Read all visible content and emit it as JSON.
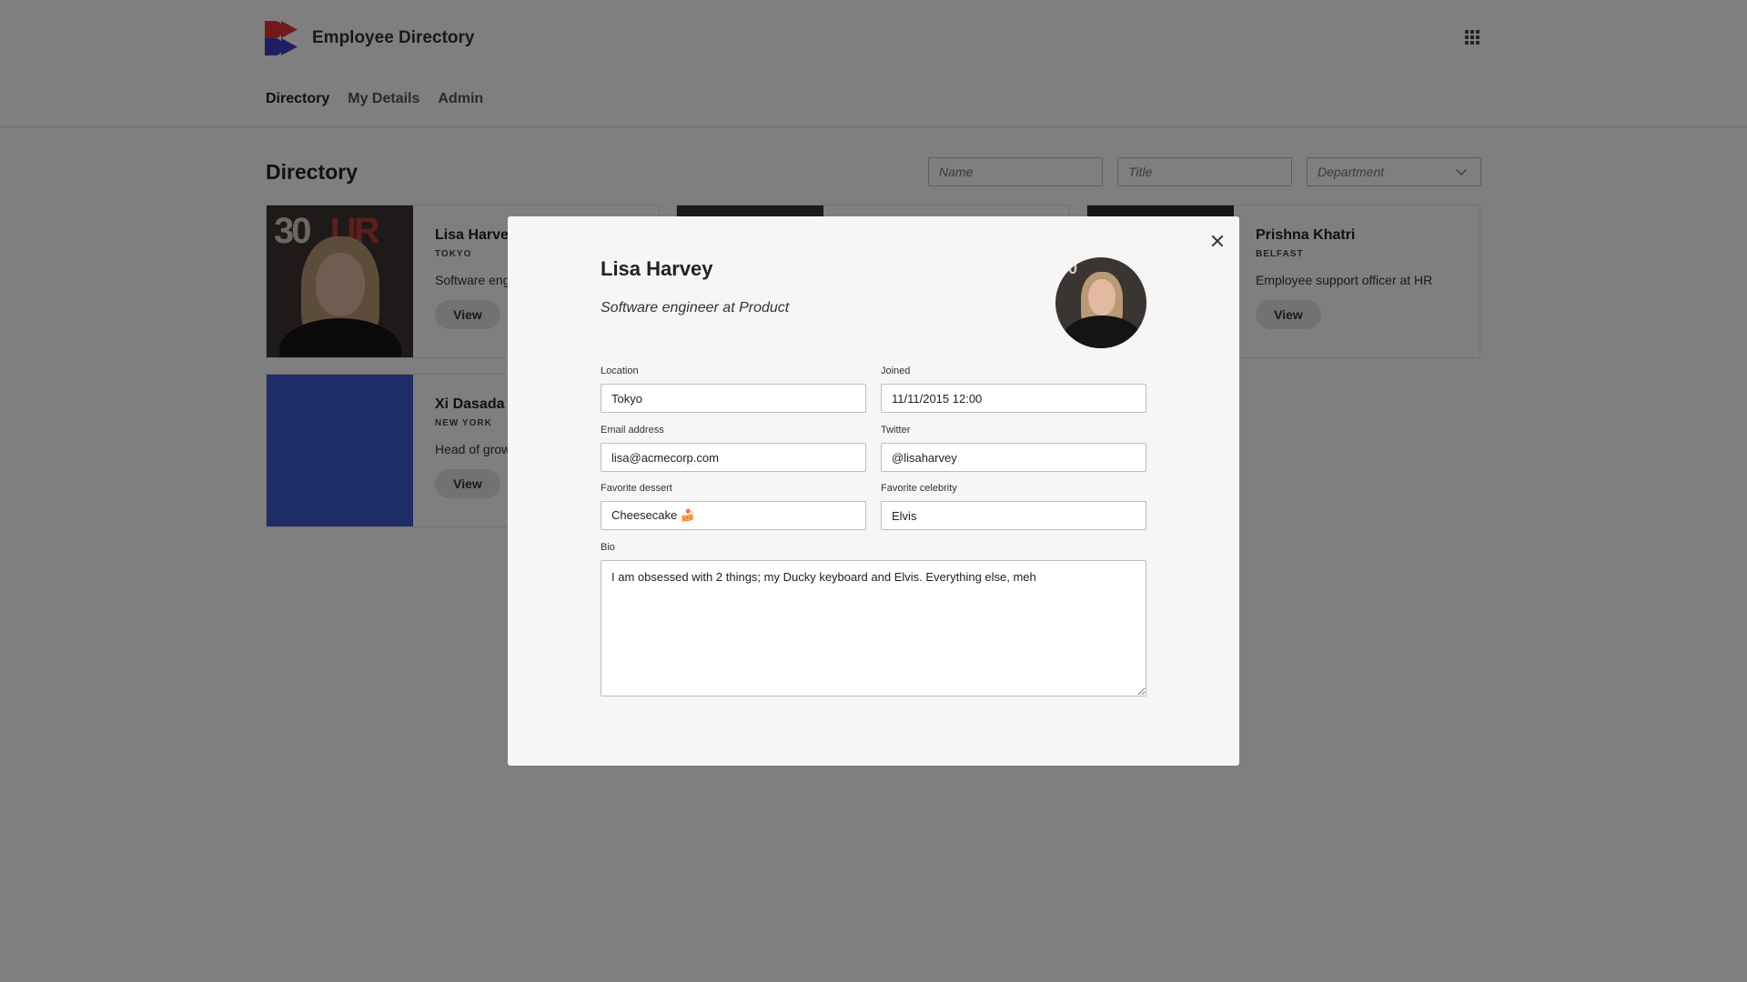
{
  "header": {
    "app_title": "Employee Directory",
    "logo_icon": "logo-icon",
    "apps_icon": "grid-icon"
  },
  "nav": {
    "items": [
      {
        "label": "Directory",
        "active": true
      },
      {
        "label": "My Details",
        "active": false
      },
      {
        "label": "Admin",
        "active": false
      }
    ]
  },
  "page": {
    "title": "Directory"
  },
  "filters": {
    "name_placeholder": "Name",
    "title_placeholder": "Title",
    "department_label": "Department"
  },
  "cards": [
    {
      "name": "Lisa Harvey",
      "location": "TOKYO",
      "role": "Software engi",
      "view_label": "View"
    },
    {
      "name": "Prishna Khatri",
      "location": "BELFAST",
      "role": "Employee support officer at HR",
      "view_label": "View"
    },
    {
      "name": "Xi Dasada",
      "location": "NEW YORK",
      "role": "Head of growt",
      "view_label": "View"
    }
  ],
  "modal": {
    "name": "Lisa Harvey",
    "subtitle": "Software engineer at Product",
    "location_label": "Location",
    "location_value": "Tokyo",
    "joined_label": "Joined",
    "joined_value": "11/11/2015 12:00",
    "email_label": "Email address",
    "email_value": "lisa@acmecorp.com",
    "twitter_label": "Twitter",
    "twitter_value": "@lisaharvey",
    "dessert_label": "Favorite dessert",
    "dessert_value": "Cheesecake 🍰",
    "celebrity_label": "Favorite celebrity",
    "celebrity_value": "Elvis",
    "bio_label": "Bio",
    "bio_value": "I am obsessed with 2 things; my Ducky keyboard and Elvis. Everything else, meh"
  },
  "colors": {
    "overlay": "#000000",
    "modal_bg": "#f6f6f6",
    "logo_red": "#e2333a",
    "logo_blue": "#3d3fc4",
    "card_blue": "#3f5bd1"
  }
}
